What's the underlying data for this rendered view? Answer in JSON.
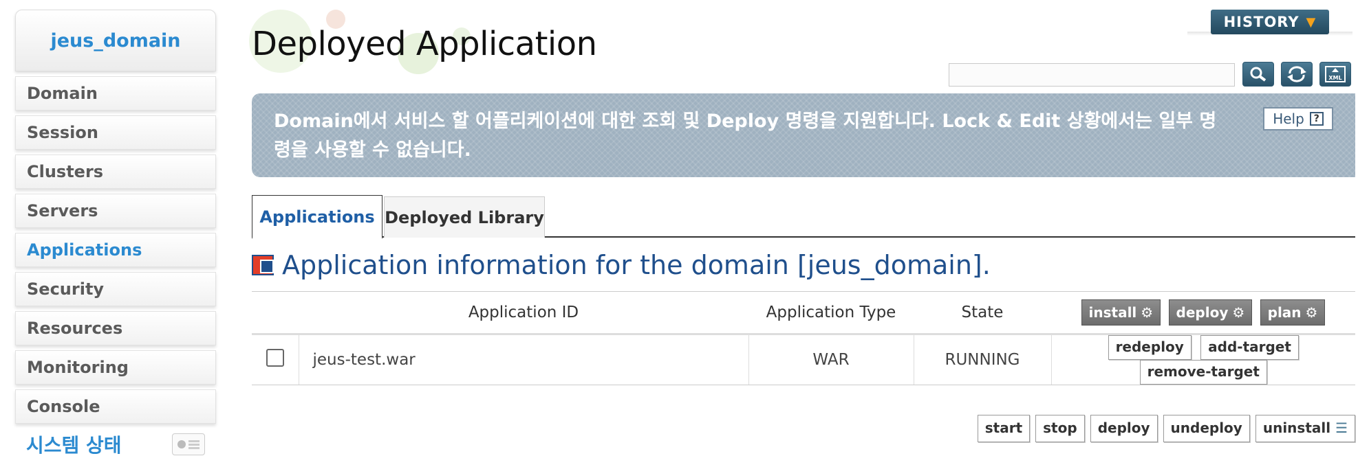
{
  "sidebar": {
    "domain_name": "jeus_domain",
    "items": [
      {
        "label": "Domain",
        "active": false
      },
      {
        "label": "Session",
        "active": false
      },
      {
        "label": "Clusters",
        "active": false
      },
      {
        "label": "Servers",
        "active": false
      },
      {
        "label": "Applications",
        "active": true
      },
      {
        "label": "Security",
        "active": false
      },
      {
        "label": "Resources",
        "active": false
      },
      {
        "label": "Monitoring",
        "active": false
      },
      {
        "label": "Console",
        "active": false
      }
    ],
    "status_label": "시스템 상태"
  },
  "header": {
    "history_label": "HISTORY",
    "title": "Deployed Application",
    "search_placeholder": "",
    "toolbar_icons": [
      "search-icon",
      "refresh-icon",
      "xml-export-icon"
    ]
  },
  "banner": {
    "text": "Domain에서 서비스 할 어플리케이션에 대한 조회 및 Deploy 명령을 지원합니다. Lock & Edit 상황에서는 일부 명령을 사용할 수 없습니다.",
    "help_label": "Help"
  },
  "tabs": [
    {
      "label": "Applications",
      "active": true
    },
    {
      "label": "Deployed Library",
      "active": false
    }
  ],
  "section_title": "Application information for the domain [jeus_domain].",
  "table": {
    "columns": [
      "Application ID",
      "Application Type",
      "State"
    ],
    "header_buttons": [
      "install",
      "deploy",
      "plan"
    ],
    "rows": [
      {
        "id": "jeus-test.war",
        "type": "WAR",
        "state": "RUNNING",
        "actions": [
          "redeploy",
          "add-target",
          "remove-target"
        ]
      }
    ]
  },
  "bottom_buttons": [
    "start",
    "stop",
    "deploy",
    "undeploy",
    "uninstall"
  ],
  "colors": {
    "accent": "#2b8ad0",
    "section_title": "#1f4f8c",
    "banner": "#9fb1c0",
    "history": "#2f5a72"
  }
}
